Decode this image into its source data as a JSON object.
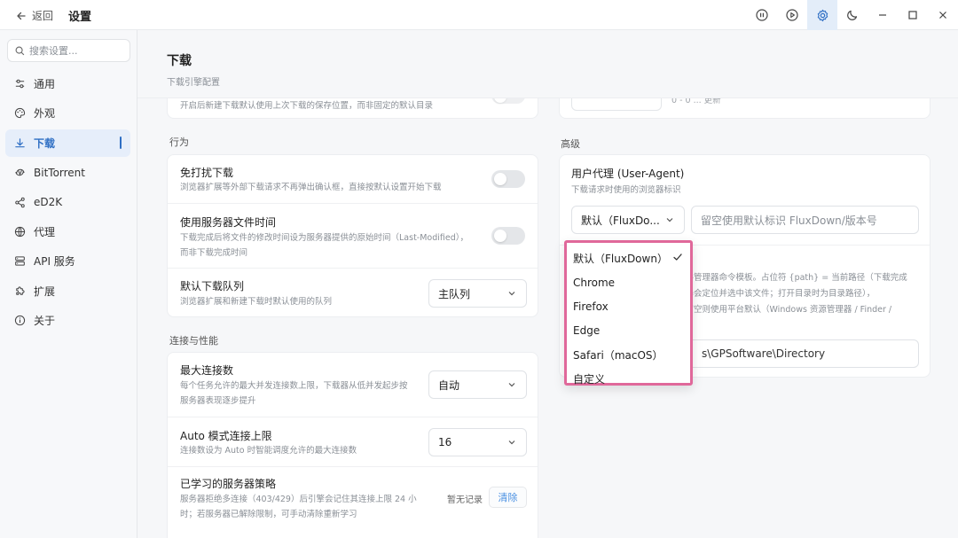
{
  "titlebar": {
    "back_label": "返回",
    "title": "设置",
    "icons": [
      "pause-circle-icon",
      "play-circle-icon",
      "gear-icon",
      "moon-icon",
      "minimize-icon",
      "maximize-icon",
      "close-icon"
    ]
  },
  "sidebar": {
    "search_placeholder": "搜索设置...",
    "items": [
      {
        "label": "通用",
        "icon": "sliders-icon"
      },
      {
        "label": "外观",
        "icon": "palette-icon"
      },
      {
        "label": "下载",
        "icon": "download-icon",
        "active": true
      },
      {
        "label": "BitTorrent",
        "icon": "bittorrent-icon"
      },
      {
        "label": "eD2K",
        "icon": "share-icon"
      },
      {
        "label": "代理",
        "icon": "globe-icon"
      },
      {
        "label": "API 服务",
        "icon": "server-icon"
      },
      {
        "label": "扩展",
        "icon": "puzzle-icon"
      },
      {
        "label": "关于",
        "icon": "info-icon"
      }
    ]
  },
  "page": {
    "title": "下载",
    "subtitle": "下载引擎配置"
  },
  "top_card": {
    "partial_desc": "开启后新建下载默认使用上次下载的保存位置，而非固定的默认目录"
  },
  "behavior": {
    "section": "行为",
    "rows": [
      {
        "title": "免打扰下载",
        "desc": "浏览器扩展等外部下载请求不再弹出确认框，直接按默认设置开始下载"
      },
      {
        "title": "使用服务器文件时间",
        "desc1": "下载完成后将文件的修改时间设为服务器提供的原始时间（Last-Modified），",
        "desc2": "而非下载完成时间"
      },
      {
        "title": "默认下载队列",
        "desc": "浏览器扩展和新建下载时默认使用的队列",
        "value": "主队列"
      }
    ]
  },
  "connection": {
    "section": "连接与性能",
    "rows": [
      {
        "title": "最大连接数",
        "desc1": "每个任务允许的最大并发连接数上限，下载器从低并发起步按",
        "desc2": "服务器表现逐步提升",
        "value": "自动"
      },
      {
        "title": "Auto 模式连接上限",
        "desc": "连接数设为 Auto 时智能调度允许的最大连接数",
        "value": "16"
      },
      {
        "title": "已学习的服务器策略",
        "desc1": "服务器拒绝多连接（403/429）后引擎会记住其连接上限 24 小",
        "desc2": "时；若服务器已解除限制，可手动清除重新学习",
        "status": "暂无记录",
        "clear": "清除"
      }
    ]
  },
  "advanced": {
    "section": "高级",
    "partial_top": "0 - 0  ... 更新",
    "ua_title": "用户代理 (User-Agent)",
    "ua_desc": "下载请求时使用的浏览器标识",
    "ua_select": "默认（FluxDo...",
    "ua_placeholder": "留空使用默认标识 FluxDown/版本号",
    "fm_desc1": "文件管理器命令模板。占位符 {path} = 当前路径（下载完成",
    "fm_desc2": "理器会定位并选中该文件；打开目录时为目录路径），",
    "fm_desc3": "。留空则使用平台默认（Windows 资源管理器 / Finder /",
    "fm_value": "s\\GPSoftware\\Directory"
  },
  "dropdown": {
    "options": [
      "默认（FluxDown）",
      "Chrome",
      "Firefox",
      "Edge",
      "Safari（macOS）",
      "自定义"
    ],
    "selected": "默认（FluxDown）",
    "highlight_color": "#e0689a"
  },
  "colors": {
    "accent": "#2f6fc4",
    "clear_link": "#4a90e2"
  }
}
